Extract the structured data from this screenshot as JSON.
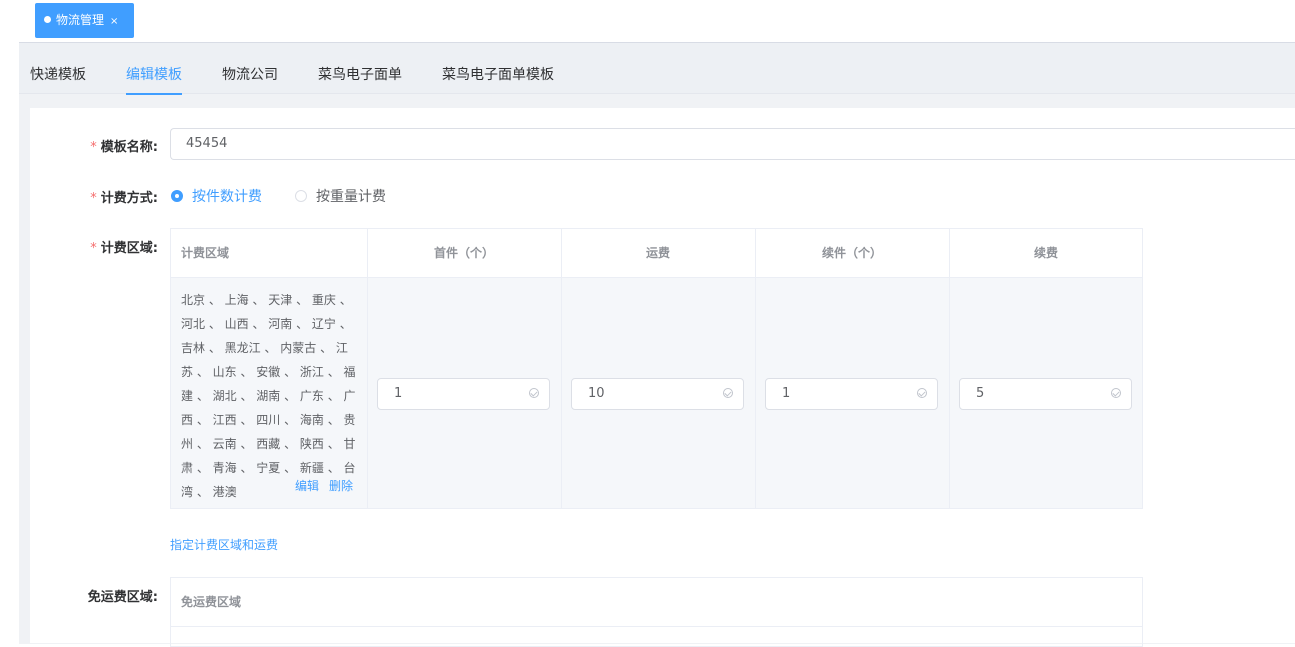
{
  "tagbar": {
    "tag_label": "物流管理",
    "close": "×"
  },
  "tabs": [
    {
      "label": "快递模板"
    },
    {
      "label": "编辑模板",
      "active": true
    },
    {
      "label": "物流公司"
    },
    {
      "label": "菜鸟电子面单"
    },
    {
      "label": "菜鸟电子面单模板"
    }
  ],
  "form": {
    "required_mark": "*",
    "name_label": "模板名称:",
    "name_value": "45454",
    "billing_label": "计费方式:",
    "billing_options": [
      {
        "label": "按件数计费",
        "selected": true
      },
      {
        "label": "按重量计费",
        "selected": false
      }
    ],
    "area_label": "计费区域:",
    "area_table": {
      "headers": [
        "计费区域",
        "首件（个）",
        "运费",
        "续件（个）",
        "续费"
      ],
      "row": {
        "regions": "北京 、 上海 、 天津 、 重庆 、 河北 、 山西 、 河南 、 辽宁 、 吉林 、 黑龙江 、 内蒙古 、 江苏 、 山东 、 安徽 、 浙江 、 福建 、 湖北 、 湖南 、 广东 、 广西 、 江西 、 四川 、 海南 、 贵州 、 云南 、 西藏 、 陕西 、 甘肃 、 青海 、 宁夏 、 新疆 、 台湾 、 港澳",
        "first": "1",
        "fee": "10",
        "next": "1",
        "next_fee": "5",
        "edit": "编辑",
        "delete": "删除"
      }
    },
    "add_area_link": "指定计费区域和运费",
    "free_label": "免运费区域:",
    "free_table_header": "免运费区域"
  },
  "colors": {
    "accent": "#409eff",
    "required": "#f56c6c"
  }
}
